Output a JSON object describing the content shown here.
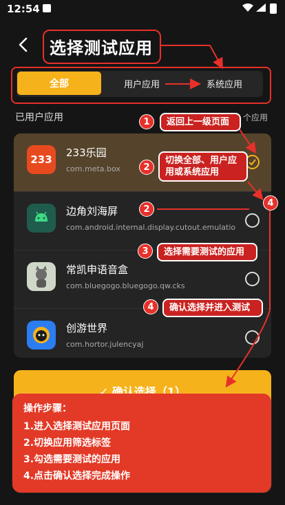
{
  "status_bar": {
    "time": "12:54"
  },
  "header": {
    "title": "选择测试应用"
  },
  "tabs": [
    {
      "label": "全部",
      "active": true
    },
    {
      "label": "用户应用",
      "active": false
    },
    {
      "label": "系统应用",
      "active": false
    }
  ],
  "section": {
    "label": "已用户应用",
    "count_label": "个应用"
  },
  "apps": [
    {
      "name": "233乐园",
      "package": "com.meta.box",
      "icon": "233-app-icon",
      "selected": true
    },
    {
      "name": "边角刘海屏",
      "package": "com.android.internal.display.cutout.emulatio",
      "icon": "android-icon",
      "selected": false
    },
    {
      "name": "常凯申语音盒",
      "package": "com.bluegogo.bluegogo.qw.cks",
      "icon": "cat-avatar-icon",
      "selected": false
    },
    {
      "name": "创游世界",
      "package": "com.hortor.julencyaj",
      "icon": "round-face-icon",
      "selected": false
    }
  ],
  "icon_233_text": "233",
  "confirm_button": {
    "label": "✓  确认选择（1）"
  },
  "steps": {
    "title": "操作步骤：",
    "items": [
      "1.进入选择测试应用页面",
      "2.切换应用筛选标签",
      "3.勾选需要测试的应用",
      "4.点击确认选择完成操作"
    ]
  },
  "annotations": [
    {
      "badge": "1",
      "text": "返回上一级页面"
    },
    {
      "badge": "2",
      "text": "切换全部、用户应用或系统应用"
    },
    {
      "badge": "2",
      "text": ""
    },
    {
      "badge": "3",
      "text": "选择需要测试的应用"
    },
    {
      "badge": "4",
      "text": "确认选择并进入测试"
    },
    {
      "badge": "4",
      "text": ""
    }
  ],
  "colors": {
    "accent": "#f6b21b",
    "annotation_red": "#e8302a",
    "background": "#151515",
    "list_bg": "#242424"
  }
}
